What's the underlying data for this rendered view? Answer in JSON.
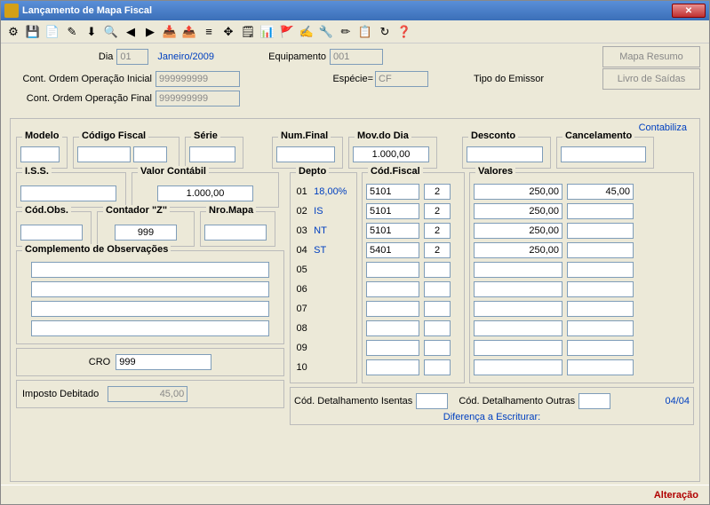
{
  "window": {
    "title": "Lançamento de Mapa Fiscal"
  },
  "header": {
    "dia_label": "Dia",
    "dia_value": "01",
    "periodo": "Janeiro/2009",
    "equip_label": "Equipamento",
    "equip_value": "001",
    "cont_ini_label": "Cont. Ordem Operação Inicial",
    "cont_ini_value": "999999999",
    "especie_label": "Espécie=",
    "especie_value": "CF",
    "tipo_emissor_label": "Tipo do Emissor",
    "cont_fim_label": "Cont. Ordem Operação Final",
    "cont_fim_value": "999999999",
    "btn_mapa": "Mapa Resumo",
    "btn_livro": "Livro de Saídas"
  },
  "main": {
    "contabiliza": "Contabiliza",
    "modelo_legend": "Modelo",
    "codfiscal_legend": "Código Fiscal",
    "serie_legend": "Série",
    "numfinal_legend": "Num.Final",
    "movdia_legend": "Mov.do Dia",
    "movdia_value": "1.000,00",
    "desconto_legend": "Desconto",
    "cancel_legend": "Cancelamento",
    "iss_legend": "I.S.S.",
    "valorcont_legend": "Valor Contábil",
    "valorcont_value": "1.000,00",
    "codobs_legend": "Cód.Obs.",
    "contadorz_legend": "Contador \"Z\"",
    "contadorz_value": "999",
    "nromapa_legend": "Nro.Mapa",
    "complobs_legend": "Complemento de Observações",
    "cro_label": "CRO",
    "cro_value": "999",
    "imposto_label": "Imposto Debitado",
    "imposto_value": "45,00",
    "depto_legend": "Depto",
    "codfiscal2_legend": "Cód.Fiscal",
    "valores_legend": "Valores",
    "depto_rows": [
      {
        "n": "01",
        "lbl": "18,00%",
        "c1": "5101",
        "c2": "2",
        "v1": "250,00",
        "v2": "45,00"
      },
      {
        "n": "02",
        "lbl": "IS",
        "c1": "5101",
        "c2": "2",
        "v1": "250,00",
        "v2": ""
      },
      {
        "n": "03",
        "lbl": "NT",
        "c1": "5101",
        "c2": "2",
        "v1": "250,00",
        "v2": ""
      },
      {
        "n": "04",
        "lbl": "ST",
        "c1": "5401",
        "c2": "2",
        "v1": "250,00",
        "v2": ""
      },
      {
        "n": "05",
        "lbl": "",
        "c1": "",
        "c2": "",
        "v1": "",
        "v2": ""
      },
      {
        "n": "06",
        "lbl": "",
        "c1": "",
        "c2": "",
        "v1": "",
        "v2": ""
      },
      {
        "n": "07",
        "lbl": "",
        "c1": "",
        "c2": "",
        "v1": "",
        "v2": ""
      },
      {
        "n": "08",
        "lbl": "",
        "c1": "",
        "c2": "",
        "v1": "",
        "v2": ""
      },
      {
        "n": "09",
        "lbl": "",
        "c1": "",
        "c2": "",
        "v1": "",
        "v2": ""
      },
      {
        "n": "10",
        "lbl": "",
        "c1": "",
        "c2": "",
        "v1": "",
        "v2": ""
      }
    ],
    "cod_det_isentas": "Cód. Detalhamento Isentas",
    "cod_det_outras": "Cód. Detalhamento Outras",
    "pagina": "04/04",
    "diferenca": "Diferença a Escriturar:"
  },
  "status": {
    "mode": "Alteração"
  },
  "icons": [
    "⚙",
    "💾",
    "📄",
    "✎",
    "⬇",
    "🔍",
    "◀",
    "▶",
    "📥",
    "📤",
    "≡",
    "✥",
    "🗒",
    "📊",
    "🚩",
    "✍",
    "🔧",
    "✏",
    "📋",
    "↻",
    "❓"
  ]
}
